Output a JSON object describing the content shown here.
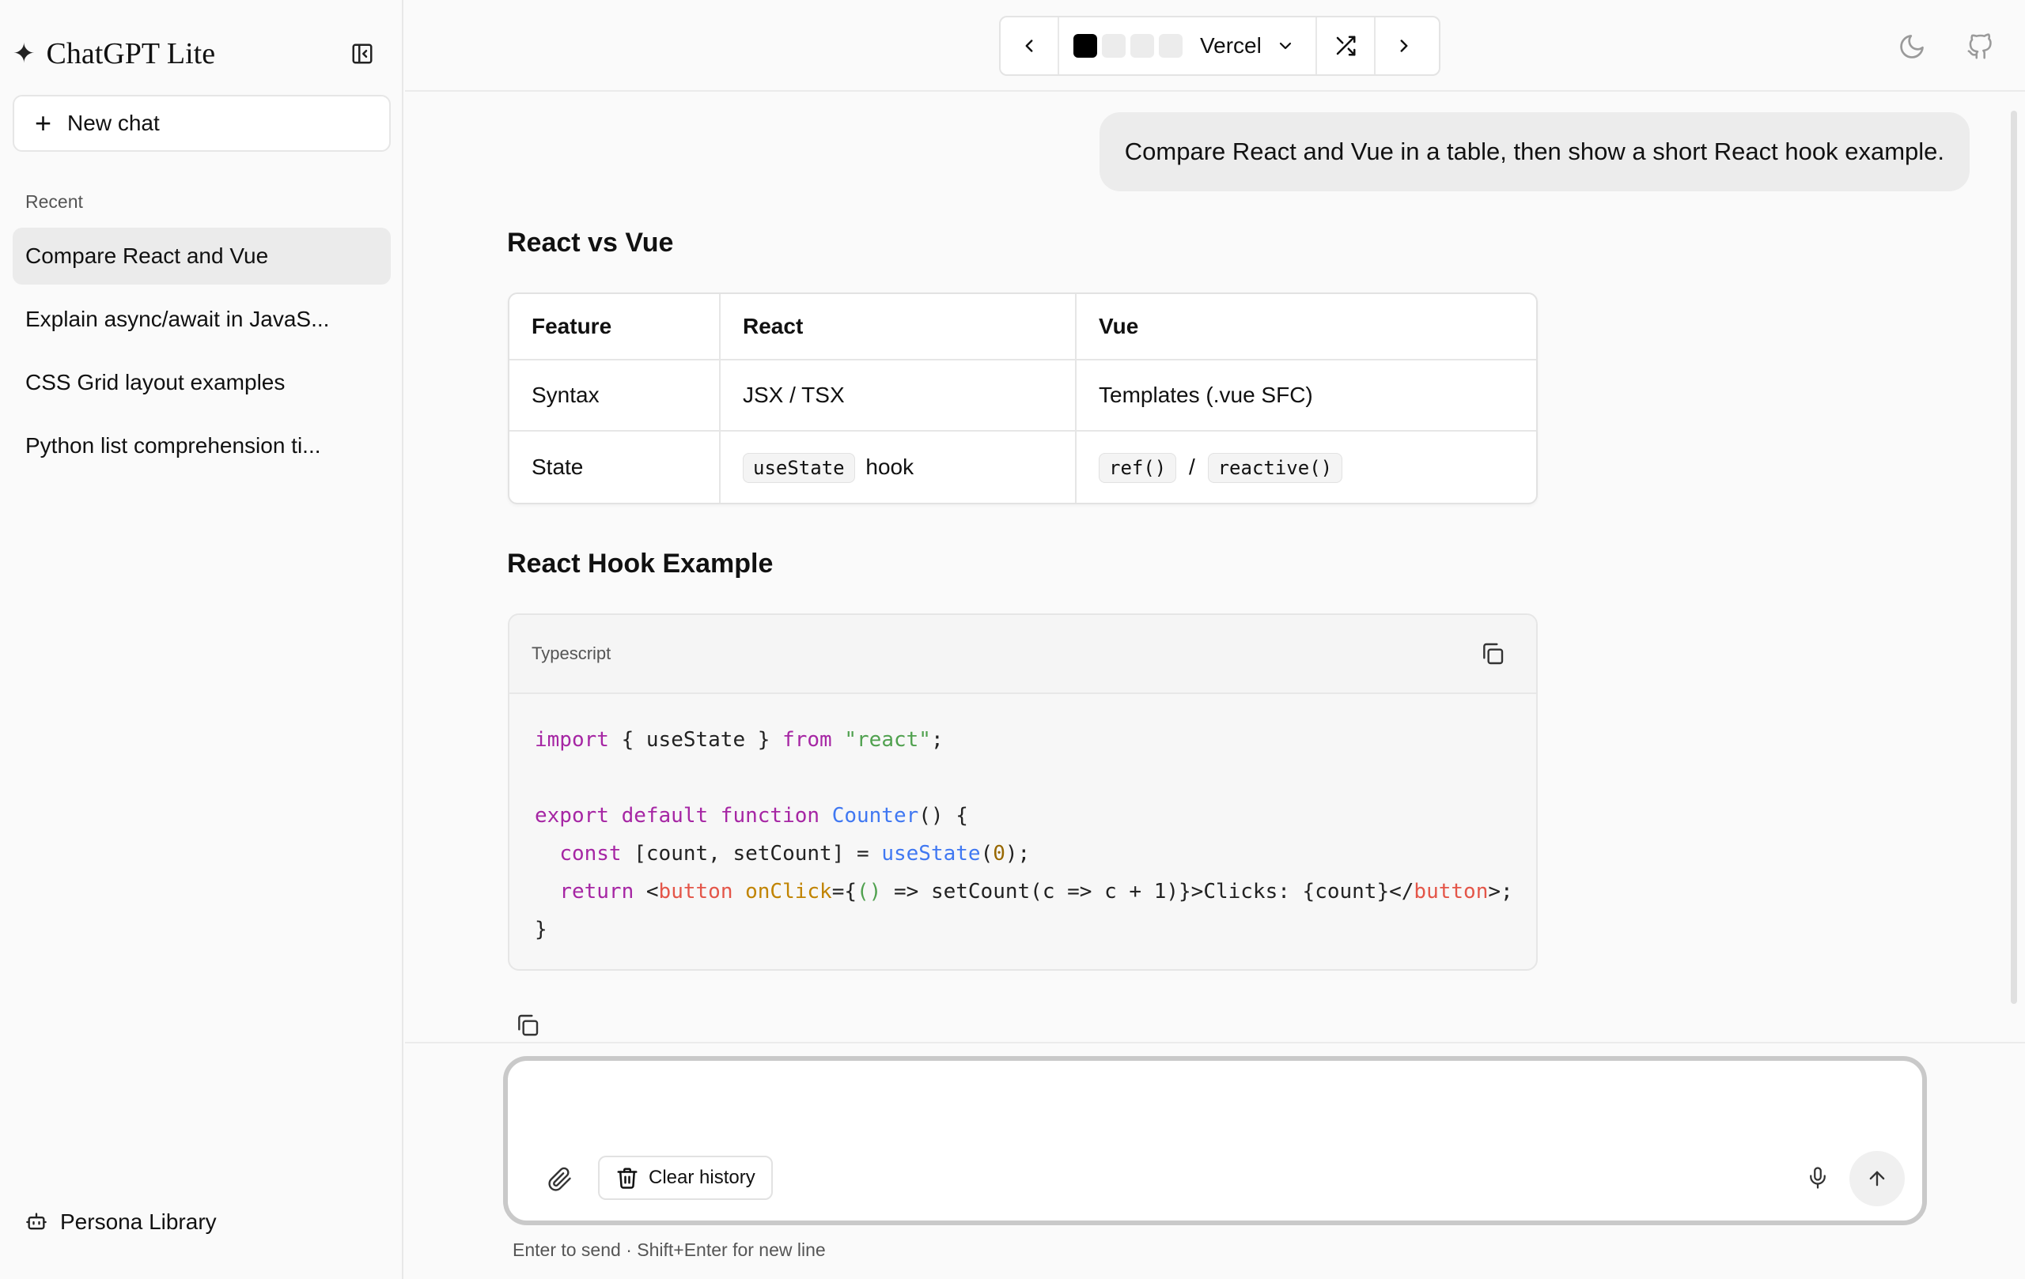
{
  "app": {
    "title": "ChatGPT Lite",
    "brand_icon": "sparkle-icon"
  },
  "sidebar": {
    "new_chat_label": "New chat",
    "recent_label": "Recent",
    "items": [
      {
        "label": "Compare React and Vue",
        "active": true
      },
      {
        "label": "Explain async/await in JavaS..."
      },
      {
        "label": "CSS Grid layout examples"
      },
      {
        "label": "Python list comprehension ti..."
      }
    ],
    "persona_label": "Persona Library"
  },
  "topbar": {
    "theme_name": "Vercel",
    "swatch_colors": [
      "#000000",
      "#ececec",
      "#ececec",
      "#ececec"
    ]
  },
  "chat": {
    "user_message": "Compare React and Vue in a table, then show a short React hook example.",
    "heading1": "React vs Vue",
    "table": {
      "headers": [
        "Feature",
        "React",
        "Vue"
      ],
      "rows": [
        {
          "feature": "Syntax",
          "react": "JSX / TSX",
          "vue": "Templates (.vue SFC)"
        },
        {
          "feature": "State",
          "react_code": "useState",
          "react_text": "hook",
          "vue_code1": "ref()",
          "vue_sep": "/",
          "vue_code2": "reactive()"
        }
      ]
    },
    "heading2": "React Hook Example",
    "code": {
      "language": "Typescript",
      "lines": [
        "import { useState } from \"react\";",
        "",
        "export default function Counter() {",
        "  const [count, setCount] = useState(0);",
        "  return <button onClick={() => setCount(c => c + 1)}>Clicks: {count}</button>;",
        "}"
      ]
    }
  },
  "composer": {
    "placeholder": "",
    "clear_label": "Clear history",
    "hint": "Enter to send · Shift+Enter for new line"
  }
}
